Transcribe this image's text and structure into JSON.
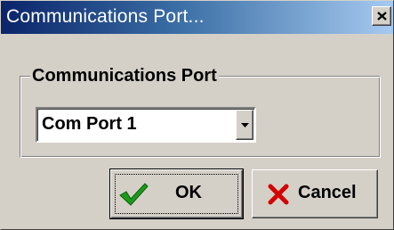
{
  "window": {
    "title": "Communications Port..."
  },
  "group": {
    "legend": "Communications Port"
  },
  "port_select": {
    "selected": "Com Port 1"
  },
  "buttons": {
    "ok_label": "OK",
    "cancel_label": "Cancel"
  },
  "icons": {
    "close": "close-icon",
    "dropdown": "chevron-down-icon",
    "ok": "checkmark-icon",
    "cancel": "x-icon"
  },
  "colors": {
    "titlebar_start": "#0a246a",
    "titlebar_end": "#a6caf0",
    "face": "#d4d0c8",
    "check_green": "#1a9a1a",
    "cancel_red": "#d40000"
  }
}
